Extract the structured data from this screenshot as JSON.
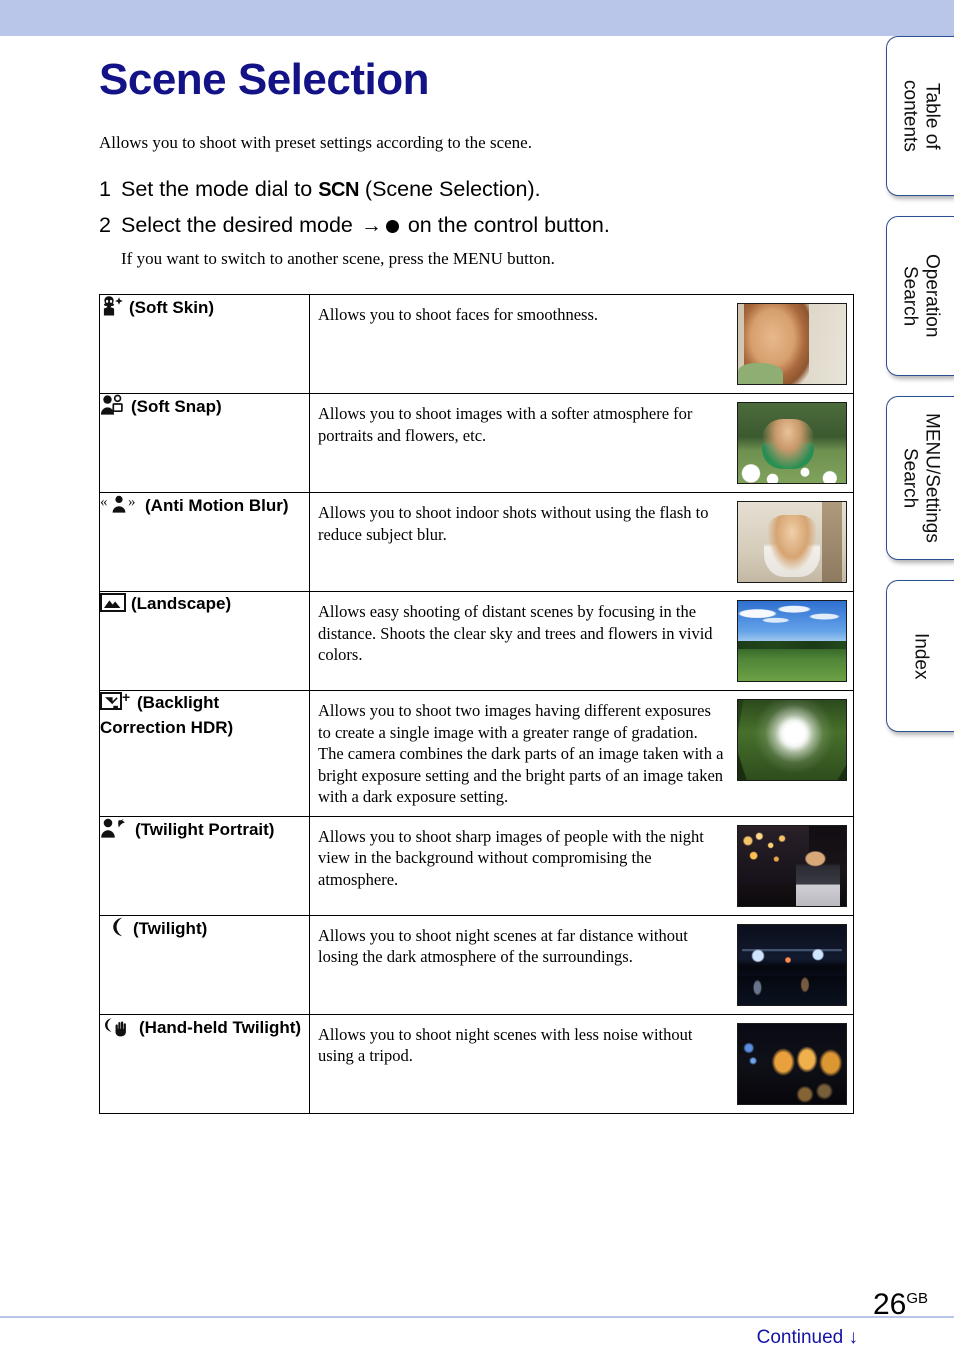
{
  "header": {
    "band_color": "#b9c6ea"
  },
  "page": {
    "title": "Scene Selection",
    "intro": "Allows you to shoot with preset settings according to the scene.",
    "title_color": "#131387"
  },
  "steps": [
    {
      "num": "1",
      "before": "Set the mode dial to ",
      "badge": "SCN",
      "after": " (Scene Selection).",
      "has_dot": false
    },
    {
      "num": "2",
      "before": "Select the desired mode ",
      "arrow": "→",
      "after": " on the control button.",
      "has_dot": true
    }
  ],
  "substep": "If you want to switch to another scene, press the MENU button.",
  "table": {
    "rows": [
      {
        "icon": "soft-skin-icon",
        "mode": "(Soft Skin)",
        "desc": "Allows you to shoot faces for smoothness.",
        "thumb": "soft-skin-thumbnail"
      },
      {
        "icon": "soft-snap-icon",
        "mode": "(Soft Snap)",
        "desc": "Allows you to shoot images with a softer atmosphere for portraits and flowers, etc.",
        "thumb": "soft-snap-thumbnail"
      },
      {
        "icon": "anti-motion-blur-icon",
        "mode": "(Anti Motion Blur)",
        "desc": "Allows you to shoot indoor shots without using the flash to reduce subject blur.",
        "thumb": "anti-motion-blur-thumbnail"
      },
      {
        "icon": "landscape-icon",
        "mode": "(Landscape)",
        "desc": "Allows easy shooting of distant scenes by focusing in the distance. Shoots the clear sky and trees and flowers in vivid colors.",
        "thumb": "landscape-thumbnail"
      },
      {
        "icon": "backlight-correction-hdr-icon",
        "mode": "(Backlight Correction HDR)",
        "desc": "Allows you to shoot two images having different exposures to create a single image with a greater range of gradation. The camera combines the dark parts of an image taken with a bright exposure setting and the bright parts of an image taken with a dark exposure setting.",
        "thumb": "backlight-hdr-thumbnail"
      },
      {
        "icon": "twilight-portrait-icon",
        "mode": "(Twilight Portrait)",
        "desc": "Allows you to shoot sharp images of people with the night view in the background without compromising the atmosphere.",
        "thumb": "twilight-portrait-thumbnail"
      },
      {
        "icon": "twilight-icon",
        "mode": "(Twilight)",
        "desc": "Allows you to shoot night scenes at far distance without losing the dark atmosphere of the surroundings.",
        "thumb": "twilight-thumbnail"
      },
      {
        "icon": "hand-held-twilight-icon",
        "mode": "(Hand-held Twilight)",
        "desc": "Allows you to shoot night scenes with less noise without using a tripod.",
        "thumb": "hand-held-twilight-thumbnail"
      }
    ]
  },
  "side_tabs": [
    {
      "label": "Table of\ncontents"
    },
    {
      "label": "Operation\nSearch"
    },
    {
      "label": "MENU/Settings\nSearch"
    },
    {
      "label": "Index"
    }
  ],
  "footer": {
    "page_number": "26",
    "page_suffix": "GB",
    "continued": "Continued ↓",
    "continued_color": "#1515a5"
  }
}
